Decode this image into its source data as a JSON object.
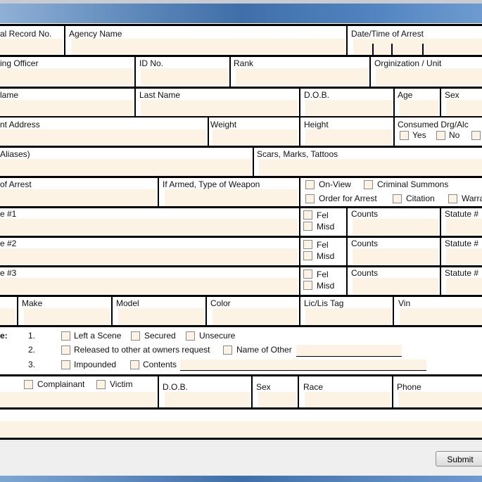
{
  "row1": {
    "record": "al Record No.",
    "agency": "Agency Name",
    "datetime": "Date/Time of Arrest"
  },
  "row2": {
    "officer": "ing Officer",
    "id": "ID No.",
    "rank": "Rank",
    "org": "Orginization / Unit"
  },
  "row3": {
    "first": "lame",
    "last": "Last Name",
    "dob": "D.O.B.",
    "age": "Age",
    "sex": "Sex"
  },
  "row4": {
    "address": "nt Address",
    "weight": "Weight",
    "height": "Height",
    "consumed": "Consumed Drg/Alc",
    "yes": "Yes",
    "no": "No"
  },
  "row5": {
    "aliases": "Aliases)",
    "scars": "Scars, Marks, Tattoos"
  },
  "row6": {
    "place": "of Arrest",
    "weapon": "If Armed, Type of Weapon",
    "onview": "On-View",
    "summons": "Criminal Summons",
    "order": "Order for Arrest",
    "citation": "Citation",
    "warrant": "Warra"
  },
  "charges": [
    {
      "label": "e #1",
      "fel": "Fel",
      "misd": "Misd",
      "counts": "Counts",
      "statute": "Statute #"
    },
    {
      "label": "e #2",
      "fel": "Fel",
      "misd": "Misd",
      "counts": "Counts",
      "statute": "Statute #"
    },
    {
      "label": "e #3",
      "fel": "Fel",
      "misd": "Misd",
      "counts": "Counts",
      "statute": "Statute #"
    }
  ],
  "vehicle": {
    "make": "Make",
    "model": "Model",
    "color": "Color",
    "tag": "Lic/Lis Tag",
    "vin": "Vin"
  },
  "disposition": {
    "label": "e:",
    "n1": "1.",
    "n2": "2.",
    "n3": "3.",
    "left": "Left a Scene",
    "secured": "Secured",
    "unsecure": "Unsecure",
    "released": "Released to other at owners request",
    "nameother": "Name of Other",
    "impounded": "Impounded",
    "contents": "Contents"
  },
  "person": {
    "complainant": "Complainant",
    "victim": "Victim",
    "dob": "D.O.B.",
    "sex": "Sex",
    "race": "Race",
    "phone": "Phone"
  },
  "submit": "Submit",
  "colors": {
    "field": "#fcf3e4",
    "titlebar": "#3f6fa8"
  }
}
